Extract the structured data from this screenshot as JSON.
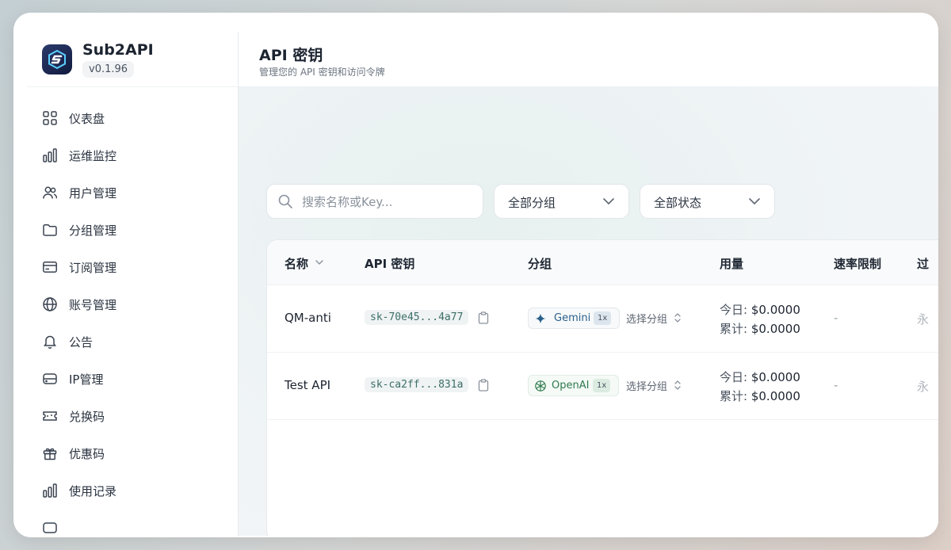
{
  "app": {
    "name": "Sub2API",
    "version": "v0.1.96"
  },
  "sidebar": {
    "items": [
      {
        "label": "仪表盘",
        "icon": "grid-icon"
      },
      {
        "label": "运维监控",
        "icon": "bar-chart-icon"
      },
      {
        "label": "用户管理",
        "icon": "users-icon"
      },
      {
        "label": "分组管理",
        "icon": "folder-icon"
      },
      {
        "label": "订阅管理",
        "icon": "credit-card-icon"
      },
      {
        "label": "账号管理",
        "icon": "globe-icon"
      },
      {
        "label": "公告",
        "icon": "bell-icon"
      },
      {
        "label": "IP管理",
        "icon": "server-icon"
      },
      {
        "label": "兑换码",
        "icon": "ticket-icon"
      },
      {
        "label": "优惠码",
        "icon": "gift-icon"
      },
      {
        "label": "使用记录",
        "icon": "bar-chart-icon"
      }
    ]
  },
  "header": {
    "title": "API 密钥",
    "subtitle": "管理您的 API 密钥和访问令牌"
  },
  "filters": {
    "search_placeholder": "搜索名称或Key...",
    "group_select": "全部分组",
    "status_select": "全部状态"
  },
  "table": {
    "columns": [
      "名称",
      "API 密钥",
      "分组",
      "用量",
      "速率限制",
      "过"
    ],
    "rows": [
      {
        "name": "QM-anti",
        "key": "sk-70e45...4a77",
        "group": {
          "name": "Gemini",
          "multiplier": "1x",
          "icon": "sparkle-icon"
        },
        "select_group": "选择分组",
        "usage_today_label": "今日:",
        "usage_today": "$0.0000",
        "usage_total_label": "累计:",
        "usage_total": "$0.0000",
        "rate_limit": "-",
        "trunc": "永"
      },
      {
        "name": "Test API",
        "key": "sk-ca2ff...831a",
        "group": {
          "name": "OpenAI",
          "multiplier": "1x",
          "icon": "openai-icon"
        },
        "select_group": "选择分组",
        "usage_today_label": "今日:",
        "usage_today": "$0.0000",
        "usage_total_label": "累计:",
        "usage_total": "$0.0000",
        "rate_limit": "-",
        "trunc": "永"
      }
    ]
  },
  "colors": {
    "gemini_text": "#2b5f8a",
    "openai_text": "#2f7a4e",
    "key_text": "#3d6e66"
  }
}
